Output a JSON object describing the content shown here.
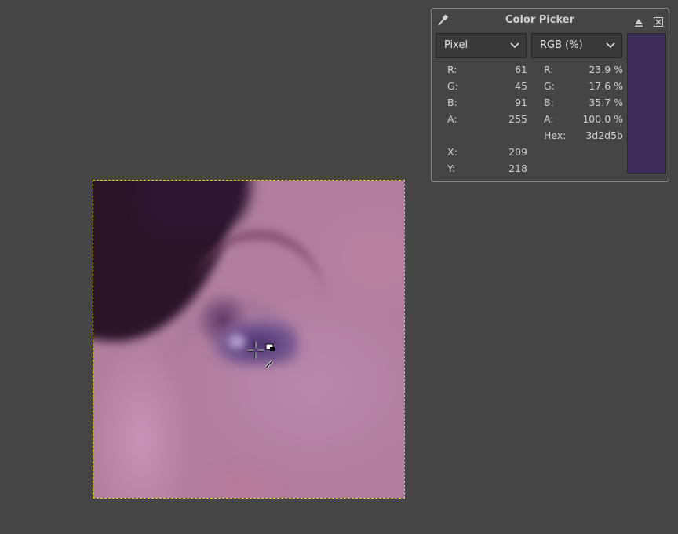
{
  "canvas": {
    "cursor": "color-picker-cursor"
  },
  "dialog": {
    "title": "Color Picker",
    "icons": {
      "picker": "eyedropper-icon",
      "detach": "detach-icon",
      "close": "close-icon"
    },
    "left_mode": "Pixel",
    "right_mode": "RGB (%)",
    "swatch_color": "#3d2d5b",
    "left": [
      {
        "label": "R:",
        "value": "61"
      },
      {
        "label": "G:",
        "value": "45"
      },
      {
        "label": "B:",
        "value": "91"
      },
      {
        "label": "A:",
        "value": "255"
      },
      {
        "label": "X:",
        "value": "209"
      },
      {
        "label": "Y:",
        "value": "218"
      }
    ],
    "right": [
      {
        "label": "R:",
        "value": "23.9 %"
      },
      {
        "label": "G:",
        "value": "17.6 %"
      },
      {
        "label": "B:",
        "value": "35.7 %"
      },
      {
        "label": "A:",
        "value": "100.0 %"
      },
      {
        "label": "Hex:",
        "value": "3d2d5b"
      }
    ]
  }
}
